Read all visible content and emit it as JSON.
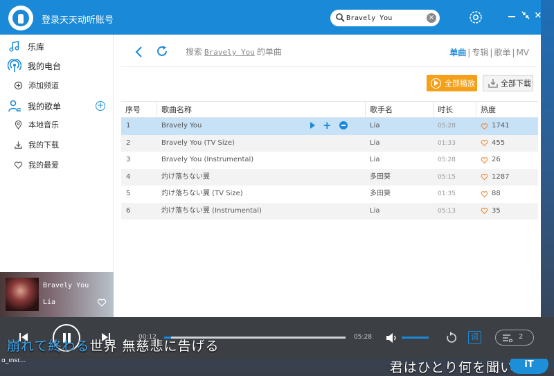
{
  "header": {
    "login_text": "登录天天动听账号",
    "search_value": "Bravely You",
    "clear_symbol": "×"
  },
  "sidebar": {
    "items": [
      {
        "label": "乐库",
        "icon": "music-note-icon"
      },
      {
        "label": "我的电台",
        "icon": "radio-icon"
      },
      {
        "label": "添加频道",
        "icon": "add-channel-icon"
      },
      {
        "label": "我的歌单",
        "icon": "playlist-user-icon"
      },
      {
        "label": "本地音乐",
        "icon": "location-pin-icon"
      },
      {
        "label": "我的下载",
        "icon": "download-icon"
      },
      {
        "label": "我的最爱",
        "icon": "heart-icon"
      }
    ],
    "add_symbol": "+"
  },
  "now_playing": {
    "title": "Bravely You",
    "artist": "Lia"
  },
  "main": {
    "crumb_prefix": "搜索",
    "keyword": "Bravely You",
    "crumb_suffix": "的单曲",
    "tabs": [
      {
        "label": "单曲",
        "active": true
      },
      {
        "label": "专辑",
        "active": false
      },
      {
        "label": "歌单",
        "active": false
      },
      {
        "label": "MV",
        "active": false
      }
    ],
    "tab_sep": "|",
    "play_all": "全部播放",
    "download_all": "全部下载",
    "columns": [
      "序号",
      "歌曲名称",
      "歌手名",
      "时长",
      "热度"
    ],
    "rows": [
      {
        "no": "1",
        "name": "Bravely You",
        "artist": "Lia",
        "duration": "05:28",
        "hot": "1741"
      },
      {
        "no": "2",
        "name": "Bravely You (TV Size)",
        "artist": "Lia",
        "duration": "01:33",
        "hot": "455"
      },
      {
        "no": "3",
        "name": "Bravely You (Instrumental)",
        "artist": "Lia",
        "duration": "05:28",
        "hot": "26"
      },
      {
        "no": "4",
        "name": "灼け落ちない翼",
        "artist": "多田葵",
        "duration": "05:15",
        "hot": "1287"
      },
      {
        "no": "5",
        "name": "灼け落ちない翼 (TV Size)",
        "artist": "多田葵",
        "duration": "01:35",
        "hot": "88"
      },
      {
        "no": "6",
        "name": "灼け落ちない翼 (Instrumental)",
        "artist": "Lia",
        "duration": "05:13",
        "hot": "35"
      }
    ]
  },
  "player": {
    "current_time": "00:12",
    "total_time": "05:28",
    "progress": 0.037,
    "volume": 1.0,
    "tune_label": "调",
    "queue_count": "2"
  },
  "lyrics": {
    "line1_sung": "崩れて終わる",
    "line1_rest": "世界 無慈悲に告げる",
    "line2": "君はひとり何を聞い"
  },
  "desktop": {
    "file_label": "d_inst..."
  },
  "colors": {
    "accent": "#1a8ad8",
    "orange": "#f5a01a",
    "selected_row": "#c7e1f7"
  }
}
